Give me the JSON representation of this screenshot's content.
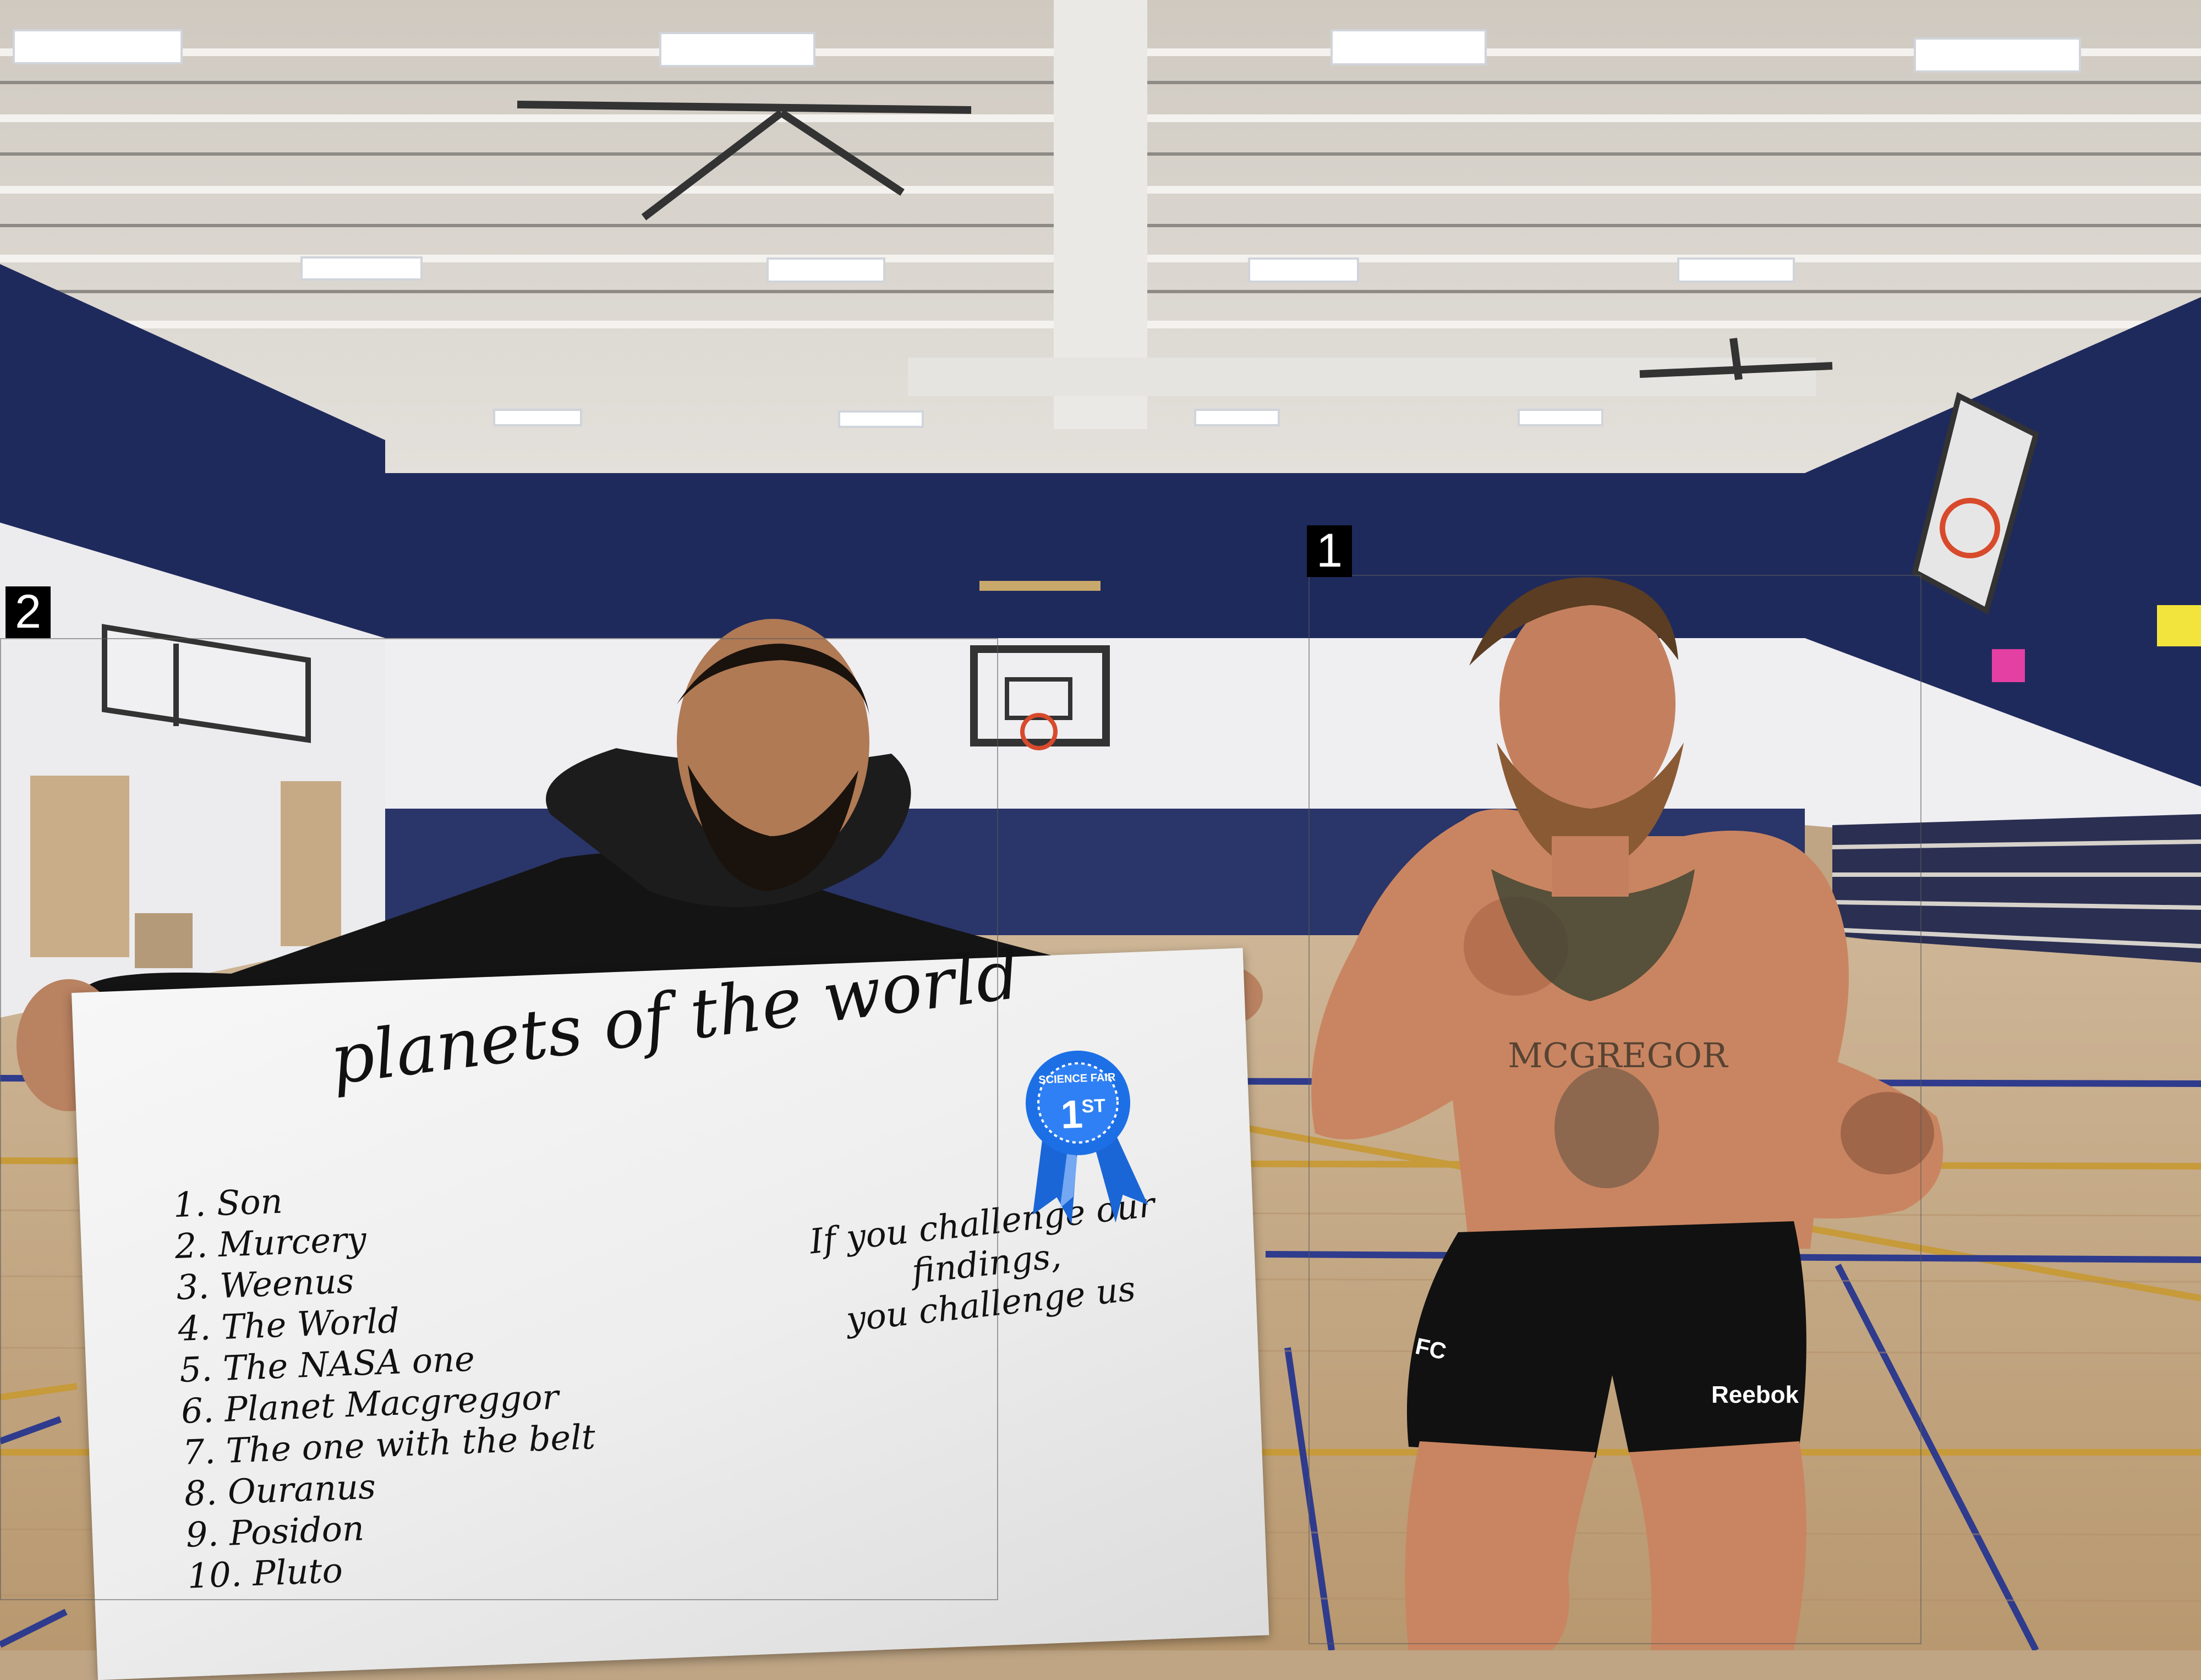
{
  "markers": {
    "one": "1",
    "two": "2"
  },
  "sign": {
    "title": "planets of the world",
    "list": [
      "1. Son",
      "2. Murcery",
      "3. Weenus",
      "4. The World",
      "5. The NASA one",
      "6. Planet Macgreggor",
      "7. The one with the belt",
      "8. Ouranus",
      "9. Posidon",
      "10. Pluto"
    ],
    "slogan_line1": "If you challenge our",
    "slogan_line2": "findings,",
    "slogan_line3": "you challenge us",
    "ribbon_top": "SCIENCE FAIR",
    "ribbon_place": "1",
    "ribbon_suffix": "ST"
  },
  "fighter": {
    "tattoo_text": "MCGREGOR",
    "shorts_brand": "Reebok",
    "shorts_logo": "FC"
  },
  "colors": {
    "wall_navy": "#1f2a5c",
    "ribbon_blue": "#1a66d6",
    "floor": "#c8ab86"
  }
}
